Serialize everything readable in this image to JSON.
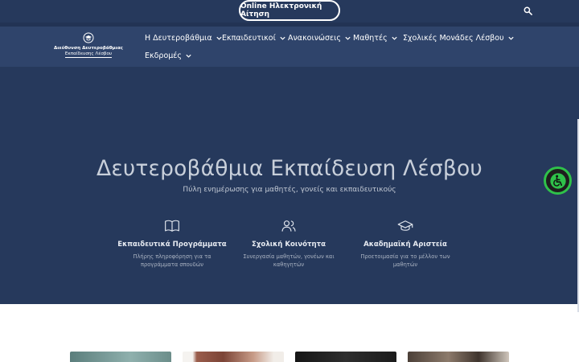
{
  "topbar": {
    "apply_button": "Online Ηλεκτρονική Αίτηση",
    "search_icon": "search-icon"
  },
  "logo": {
    "line1": "Διεύθυνση Δευτεροβάθμιας",
    "line2": "Εκπαίδευσης Λέσβου"
  },
  "nav": {
    "items": [
      {
        "label": "Η Δευτεροβάθμια"
      },
      {
        "label": "Εκπαιδευτικοί"
      },
      {
        "label": "Ανακοινώσεις"
      },
      {
        "label": "Μαθητές"
      },
      {
        "label": "Σχολικές Μονάδες Λέσβου"
      },
      {
        "label": "Εκδρομές"
      }
    ]
  },
  "hero": {
    "title": "Δευτεροβάθμια Εκπαίδευση Λέσβου",
    "subtitle": "Πύλη ενημέρωσης για μαθητές, γονείς και εκπαιδευτικούς",
    "features": [
      {
        "icon": "book-icon",
        "title": "Εκπαιδευτικά Προγράμματα",
        "desc": "Πλήρης πληροφόρηση για τα προγράμματα σπουδών"
      },
      {
        "icon": "users-icon",
        "title": "Σχολική Κοινότητα",
        "desc": "Συνεργασία μαθητών, γονέων και καθηγητών"
      },
      {
        "icon": "graduation-cap-icon",
        "title": "Ακαδημαϊκή Αριστεία",
        "desc": "Προετοιμασία για το μέλλον των μαθητών"
      }
    ]
  },
  "accessibility": {
    "icon": "accessibility-icon"
  },
  "colors": {
    "topbar": "#26395c",
    "navbar": "#2f446b",
    "hero": "#26395c",
    "accessibility_ring": "#2fc14a"
  }
}
